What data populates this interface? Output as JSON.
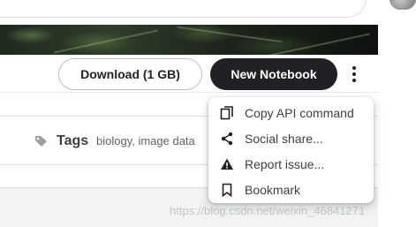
{
  "toolbar": {
    "download_label": "Download (1 GB)",
    "new_notebook_label": "New Notebook"
  },
  "tags": {
    "label": "Tags",
    "values": "biology, image data"
  },
  "menu": {
    "items": [
      {
        "label": "Copy API command",
        "icon": "copy-icon"
      },
      {
        "label": "Social share...",
        "icon": "share-icon"
      },
      {
        "label": "Report issue...",
        "icon": "warning-icon"
      },
      {
        "label": "Bookmark",
        "icon": "bookmark-icon"
      }
    ]
  },
  "watermark": "https://blog.csdn.net/weixin_46841271",
  "colors": {
    "primary_button": "#202124",
    "outline_border": "#bdc1c6",
    "menu_text": "#3c4043"
  }
}
